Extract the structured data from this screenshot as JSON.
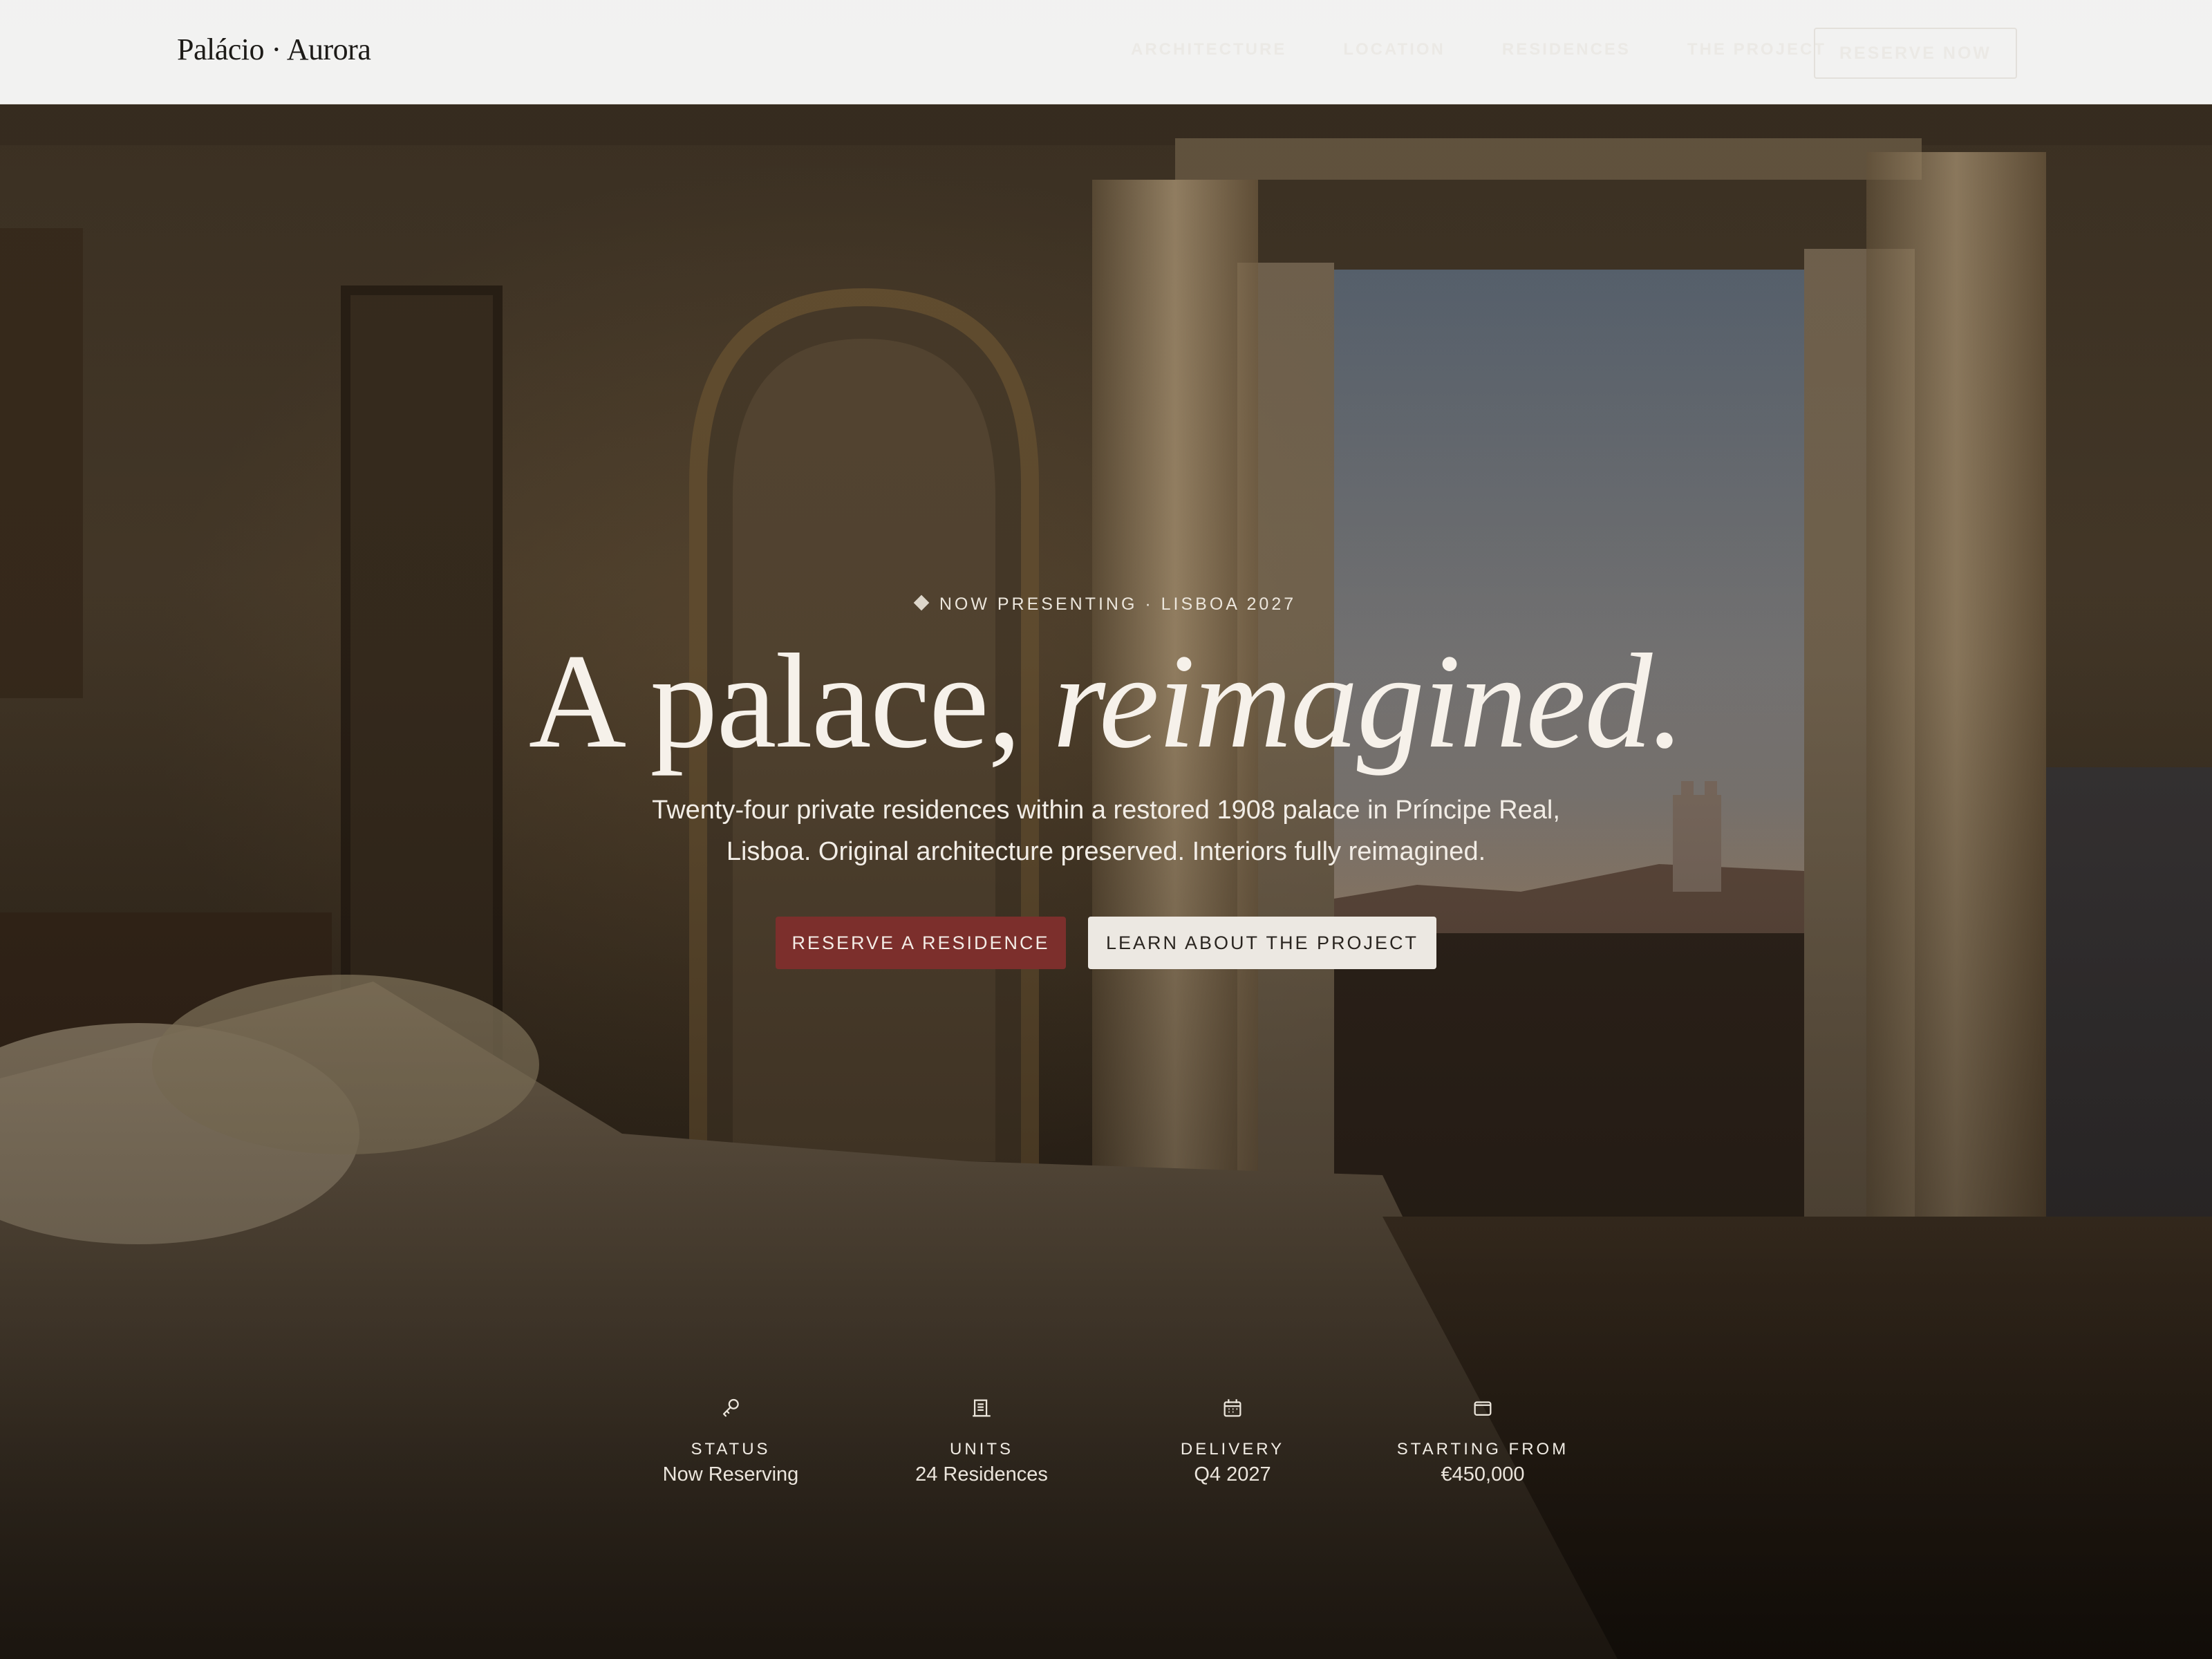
{
  "brand": {
    "name": "Palácio · Aurora"
  },
  "nav": {
    "items": [
      {
        "label": "ARCHITECTURE"
      },
      {
        "label": "LOCATION"
      },
      {
        "label": "RESIDENCES"
      },
      {
        "label": "THE PROJECT"
      }
    ],
    "cta_label": "RESERVE NOW"
  },
  "hero": {
    "eyebrow": "NOW PRESENTING · LISBOA 2027",
    "headline_regular": "A palace, ",
    "headline_italic": "reimagined.",
    "subhead": "Twenty-four private residences within a restored 1908 palace in Príncipe Real, Lisboa. Original architecture preserved. Interiors fully reimagined.",
    "primary_cta": "RESERVE A RESIDENCE",
    "secondary_cta": "LEARN ABOUT THE PROJECT"
  },
  "stats": [
    {
      "icon": "key-icon",
      "label": "STATUS",
      "value": "Now Reserving"
    },
    {
      "icon": "building-icon",
      "label": "UNITS",
      "value": "24 Residences"
    },
    {
      "icon": "calendar-icon",
      "label": "DELIVERY",
      "value": "Q4 2027"
    },
    {
      "icon": "wallet-icon",
      "label": "STARTING FROM",
      "value": "€450,000"
    }
  ],
  "colors": {
    "primary_button": "#7c2f2c",
    "secondary_button": "#ece8e2",
    "nav_background": "#fafafa",
    "hero_text": "#f6f1ea"
  }
}
